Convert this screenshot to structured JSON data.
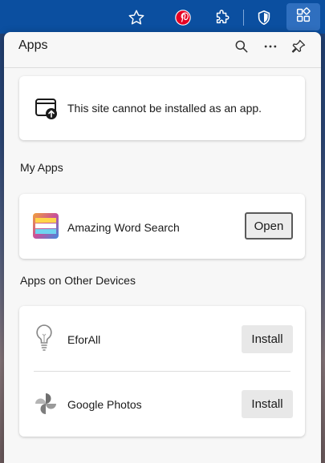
{
  "panel": {
    "title": "Apps",
    "icons": [
      "search-icon",
      "more-icon",
      "pin-icon"
    ]
  },
  "notice": {
    "text": "This site cannot be installed as an app.",
    "icon": "install-app-icon"
  },
  "my_apps": {
    "label": "My Apps",
    "items": [
      {
        "name": "Amazing Word Search",
        "icon": "amazing-word-search-icon",
        "button": "Open"
      }
    ]
  },
  "other_devices": {
    "label": "Apps on Other Devices",
    "items": [
      {
        "name": "EforAll",
        "icon": "lightbulb-icon",
        "button": "Install"
      },
      {
        "name": "Google Photos",
        "icon": "pinwheel-icon",
        "button": "Install"
      }
    ]
  },
  "toolbar": {
    "icons": [
      "star-icon",
      "pinterest-icon",
      "extensions-icon",
      "shield-icon",
      "apps-icon"
    ]
  },
  "colors": {
    "toolbar": "#0b4fa0",
    "pinterest": "#e60023",
    "panel_bg": "#f7f7f7"
  }
}
